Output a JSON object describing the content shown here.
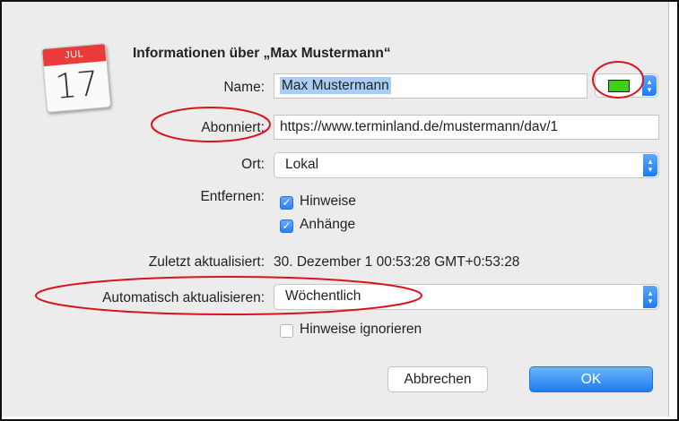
{
  "dialog": {
    "title": "Informationen über „Max Mustermann“",
    "icon": {
      "name": "calendar-icon",
      "month": "JUL",
      "day": "17",
      "accent": "#ea3b3b"
    },
    "name_label": "Name:",
    "name_value": "Max Mustermann",
    "color_swatch": "#3ecf1b",
    "subscribed_label": "Abonniert:",
    "subscribed_value": "https://www.terminland.de/mustermann/dav/1",
    "location_label": "Ort:",
    "location_value": "Lokal",
    "remove_label": "Entfernen:",
    "remove_options": [
      {
        "label": "Hinweise",
        "checked": true
      },
      {
        "label": "Anhänge",
        "checked": true
      }
    ],
    "last_updated_label": "Zuletzt aktualisiert:",
    "last_updated_value": "30. Dezember 1 00:53:28 GMT+0:53:28",
    "auto_refresh_label": "Automatisch aktualisieren:",
    "auto_refresh_value": "Wöchentlich",
    "ignore_alerts": {
      "label": "Hinweise ignorieren",
      "checked": false
    },
    "cancel_label": "Abbrechen",
    "ok_label": "OK"
  },
  "colors": {
    "accent": "#1d7df0",
    "annotation": "#d9141e",
    "selection": "#a9cdf5"
  }
}
